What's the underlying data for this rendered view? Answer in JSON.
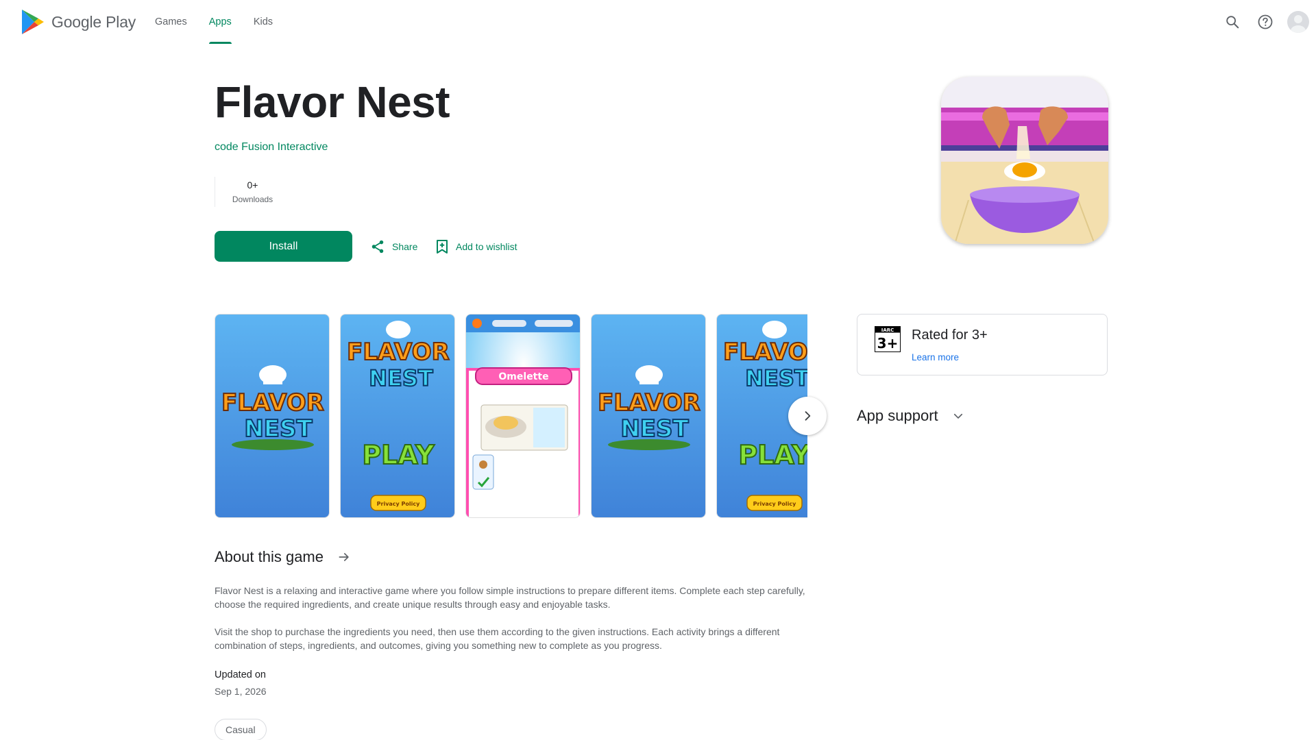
{
  "header": {
    "logo_text": "Google Play",
    "nav": [
      "Games",
      "Apps",
      "Kids"
    ],
    "active_nav": "Apps"
  },
  "app": {
    "title": "Flavor Nest",
    "developer": "code Fusion Interactive",
    "downloads_value": "0+",
    "downloads_label": "Downloads",
    "install_label": "Install",
    "share_label": "Share",
    "wishlist_label": "Add to wishlist"
  },
  "screenshots": {
    "omelette_banner": "Omelette",
    "play_label": "PLAY",
    "privacy_label": "Privacy Policy",
    "title_line1": "FLAVOR",
    "title_line2": "NEST"
  },
  "rating": {
    "badge": "3+",
    "title": "Rated for 3+",
    "link": "Learn more"
  },
  "support": {
    "label": "App support"
  },
  "about": {
    "heading": "About this game",
    "paragraph1": "Flavor Nest is a relaxing and interactive game where you follow simple instructions to prepare different items. Complete each step carefully, choose the required ingredients, and create unique results through easy and enjoyable tasks.",
    "paragraph2": "Visit the shop to purchase the ingredients you need, then use them according to the given instructions. Each activity brings a different combination of steps, ingredients, and outcomes, giving you something new to complete as you progress.",
    "updated_label": "Updated on",
    "updated_value": "Sep 1, 2026",
    "tag": "Casual"
  },
  "colors": {
    "accent": "#01875f",
    "link": "#1a73e8"
  }
}
